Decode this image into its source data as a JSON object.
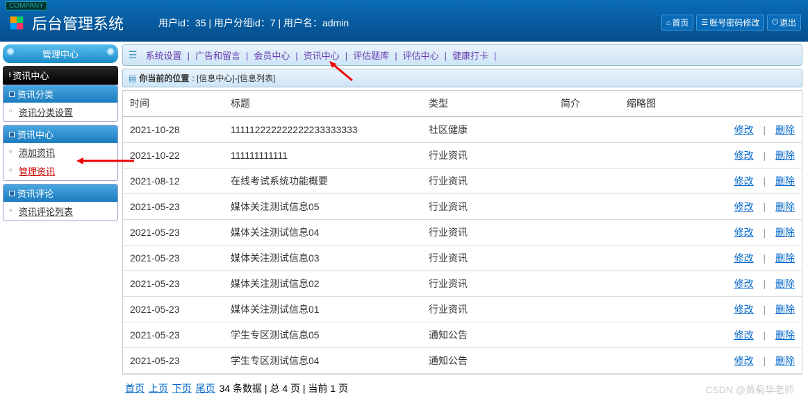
{
  "header": {
    "company_tag": "COMPANY",
    "title": "后台管理系统",
    "user_info": "用户id：35 | 用户分组id：7 | 用户名：admin",
    "buttons": {
      "home": "首页",
      "pwd": "账号密码修改",
      "logout": "退出"
    }
  },
  "sidebar": {
    "mgmt": "管理中心",
    "section_title": "资讯中心",
    "groups": [
      {
        "title": "资讯分类",
        "items": [
          {
            "label": "资讯分类设置",
            "active": false
          }
        ]
      },
      {
        "title": "资讯中心",
        "items": [
          {
            "label": "添加资讯",
            "active": false
          },
          {
            "label": "管理资讯",
            "active": true
          }
        ]
      },
      {
        "title": "资讯评论",
        "items": [
          {
            "label": "资讯评论列表",
            "active": false
          }
        ]
      }
    ]
  },
  "topnav": [
    "系统设置",
    "广告和留言",
    "会员中心",
    "资讯中心",
    "评估题库",
    "评估中心",
    "健康打卡"
  ],
  "breadcrumb": {
    "label": "你当前的位置",
    "path": ": [信息中心]-[信息列表]"
  },
  "table": {
    "headers": {
      "time": "时间",
      "title": "标题",
      "type": "类型",
      "intro": "简介",
      "thumb": "缩略图"
    },
    "actions": {
      "edit": "修改",
      "delete": "删除"
    },
    "rows": [
      {
        "time": "2021-10-28",
        "title": "111112222222222233333333",
        "type": "社区健康",
        "intro": "",
        "thumb": ""
      },
      {
        "time": "2021-10-22",
        "title": "111111111111",
        "type": "行业资讯",
        "intro": "",
        "thumb": ""
      },
      {
        "time": "2021-08-12",
        "title": "在线考试系统功能概要",
        "type": "行业资讯",
        "intro": "",
        "thumb": ""
      },
      {
        "time": "2021-05-23",
        "title": "媒体关注测试信息05",
        "type": "行业资讯",
        "intro": "",
        "thumb": ""
      },
      {
        "time": "2021-05-23",
        "title": "媒体关注测试信息04",
        "type": "行业资讯",
        "intro": "",
        "thumb": ""
      },
      {
        "time": "2021-05-23",
        "title": "媒体关注测试信息03",
        "type": "行业资讯",
        "intro": "",
        "thumb": ""
      },
      {
        "time": "2021-05-23",
        "title": "媒体关注测试信息02",
        "type": "行业资讯",
        "intro": "",
        "thumb": ""
      },
      {
        "time": "2021-05-23",
        "title": "媒体关注测试信息01",
        "type": "行业资讯",
        "intro": "",
        "thumb": ""
      },
      {
        "time": "2021-05-23",
        "title": "学生专区测试信息05",
        "type": "通知公告",
        "intro": "",
        "thumb": ""
      },
      {
        "time": "2021-05-23",
        "title": "学生专区测试信息04",
        "type": "通知公告",
        "intro": "",
        "thumb": ""
      }
    ]
  },
  "pager": {
    "first": "首页",
    "prev": "上页",
    "next": "下页",
    "last": "尾页",
    "info": "34 条数据 | 总 4 页 | 当前 1 页"
  },
  "watermark": "CSDN @黄菊华老师"
}
